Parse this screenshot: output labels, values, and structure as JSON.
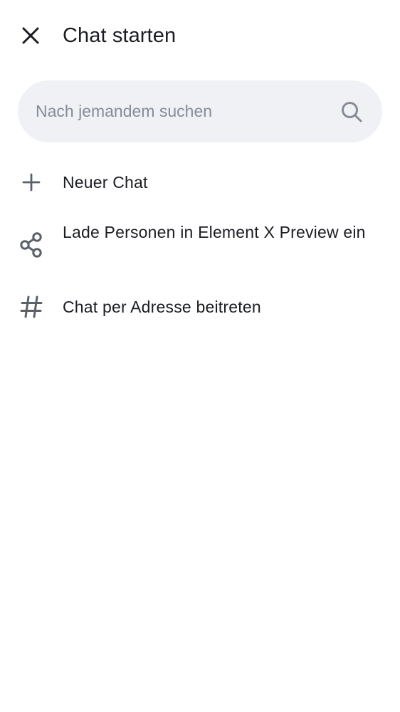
{
  "header": {
    "title": "Chat starten",
    "close_icon": "close-icon"
  },
  "search": {
    "placeholder": "Nach jemandem suchen",
    "value": "",
    "icon": "search-icon"
  },
  "actions": [
    {
      "label": "Neuer Chat",
      "icon": "plus-icon"
    },
    {
      "label": "Lade Personen in Element X Preview ein",
      "icon": "share-icon"
    },
    {
      "label": "Chat per Adresse beitreten",
      "icon": "hashtag-icon"
    }
  ],
  "colors": {
    "icon": "#5b616b",
    "text": "#1b1d22",
    "search_bg": "#eff1f5",
    "placeholder": "#868b96",
    "background": "#ffffff"
  }
}
